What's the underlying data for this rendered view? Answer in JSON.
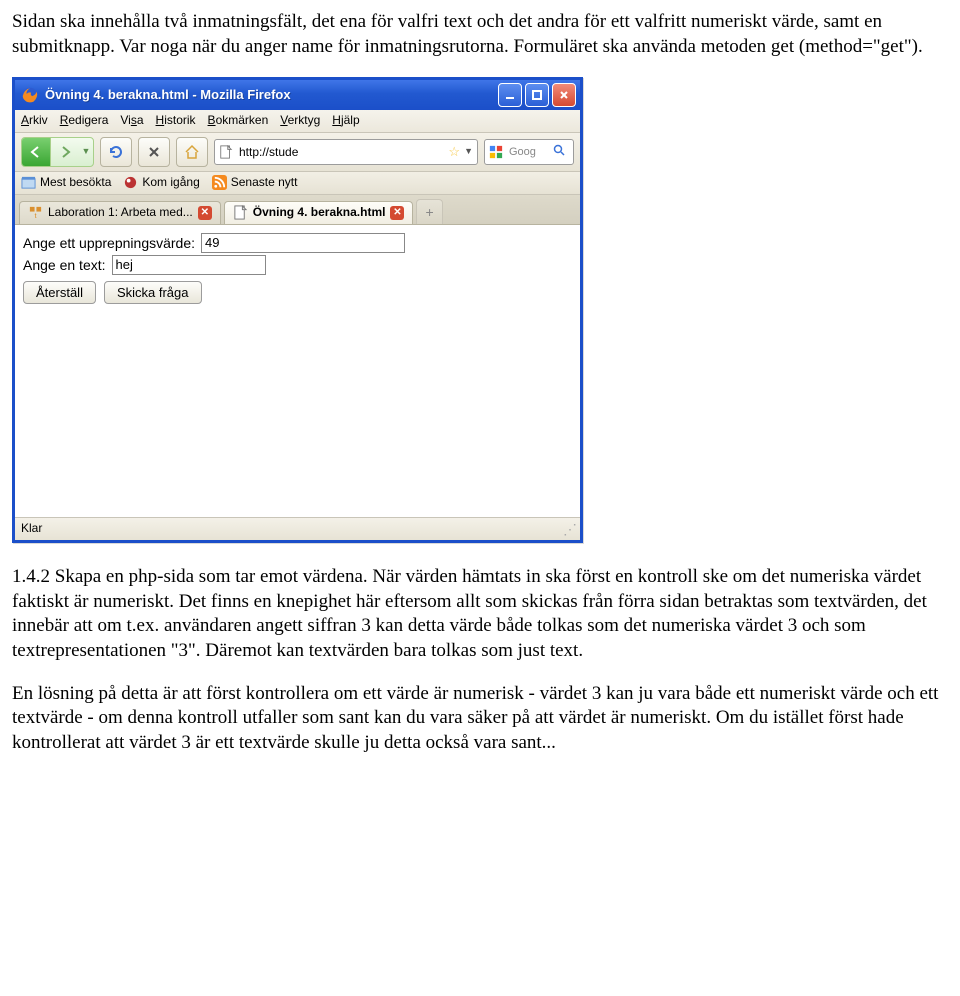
{
  "intro_paragraph": "Sidan ska innehålla två inmatningsfält, det ena för valfri text och det andra för ett valfritt numeriskt värde, samt en submitknapp. Var noga när du anger name för inmatningsrutorna. Formuläret ska använda metoden get (method=\"get\").",
  "browser": {
    "title": "Övning 4. berakna.html - Mozilla Firefox",
    "menu": {
      "arkiv": "Arkiv",
      "redigera": "Redigera",
      "visa": "Visa",
      "historik": "Historik",
      "bokmarken": "Bokmärken",
      "verktyg": "Verktyg",
      "hjalp": "Hjälp",
      "ul": {
        "arkiv": "A",
        "redigera": "R",
        "visa": "s",
        "historik": "H",
        "bokmarken": "B",
        "verktyg": "V",
        "hjalp": "H"
      }
    },
    "address": "http://stude",
    "search_placeholder": "Goog",
    "bookmarks": {
      "most_visited": "Mest besökta",
      "kom_igang": "Kom igång",
      "senaste_nytt": "Senaste nytt"
    },
    "tabs": {
      "inactive": "Laboration 1: Arbeta med...",
      "active": "Övning 4. berakna.html"
    },
    "form": {
      "label_repeat": "Ange ett upprepningsvärde:",
      "value_repeat": "49",
      "label_text": "Ange en text:",
      "value_text": "hej",
      "btn_reset": "Återställ",
      "btn_submit": "Skicka fråga"
    },
    "status": "Klar"
  },
  "section_heading": "1.4.2 Skapa en php-sida som tar emot värdena. ",
  "section_body": "När värden hämtats in ska först en kontroll ske om det numeriska värdet faktiskt är numeriskt. Det finns en knepighet här eftersom allt som skickas från förra sidan betraktas som textvärden, det innebär att om t.ex. användaren angett siffran 3 kan detta värde både tolkas som det numeriska värdet 3 och som textrepresentationen \"3\". Däremot kan textvärden bara tolkas som just text.",
  "closing_paragraph": "En lösning på detta är att först kontrollera om ett värde är numerisk - värdet 3 kan ju vara både ett numeriskt värde och ett textvärde - om denna kontroll utfaller som sant kan du vara säker på att värdet är numeriskt. Om du istället först hade kontrollerat att värdet 3 är ett textvärde skulle ju detta också vara sant..."
}
